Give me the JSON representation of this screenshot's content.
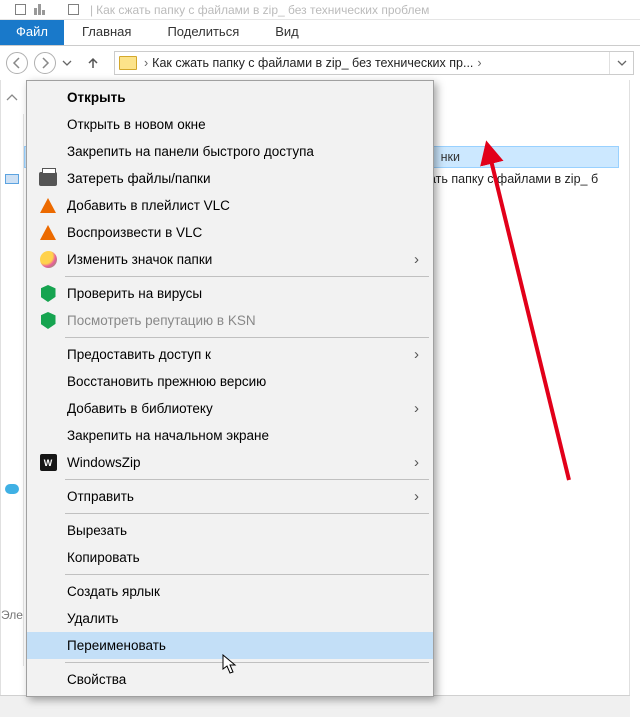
{
  "titlebar": {
    "title": "Как сжать папку с файлами в zip_ без технических проблем"
  },
  "ribbon": {
    "file": "Файл",
    "tabs": [
      "Главная",
      "Поделиться",
      "Вид"
    ]
  },
  "breadcrumb": {
    "item": "Как сжать папку с файлами в zip_ без технических пр..."
  },
  "navpane": {
    "label_truncated": "Эле"
  },
  "listing": {
    "header_fragment": "нки",
    "row_fragment": "ать папку с файлами в zip_ б"
  },
  "context_menu": {
    "items": [
      {
        "label": "Открыть",
        "bold": true
      },
      {
        "label": "Открыть в новом окне"
      },
      {
        "label": "Закрепить на панели быстрого доступа"
      },
      {
        "label": "Затереть файлы/папки",
        "icon": "printer"
      },
      {
        "label": "Добавить в плейлист VLC",
        "icon": "vlc"
      },
      {
        "label": "Воспроизвести в VLC",
        "icon": "vlc"
      },
      {
        "label": "Изменить значок папки",
        "icon": "fico",
        "arrow": true,
        "sep_after": true
      },
      {
        "label": "Проверить на вирусы",
        "icon": "kasp"
      },
      {
        "label": "Посмотреть репутацию в KSN",
        "icon": "kasp",
        "disabled": true,
        "sep_after": true
      },
      {
        "label": "Предоставить доступ к",
        "arrow": true
      },
      {
        "label": "Восстановить прежнюю версию"
      },
      {
        "label": "Добавить в библиотеку",
        "arrow": true
      },
      {
        "label": "Закрепить на начальном экране"
      },
      {
        "label": "WindowsZip",
        "icon": "wz",
        "arrow": true,
        "sep_after": true
      },
      {
        "label": "Отправить",
        "arrow": true,
        "sep_after": true
      },
      {
        "label": "Вырезать"
      },
      {
        "label": "Копировать",
        "sep_after": true
      },
      {
        "label": "Создать ярлык"
      },
      {
        "label": "Удалить"
      },
      {
        "label": "Переименовать",
        "sep_after": true,
        "hover": true
      },
      {
        "label": "Свойства"
      }
    ]
  }
}
